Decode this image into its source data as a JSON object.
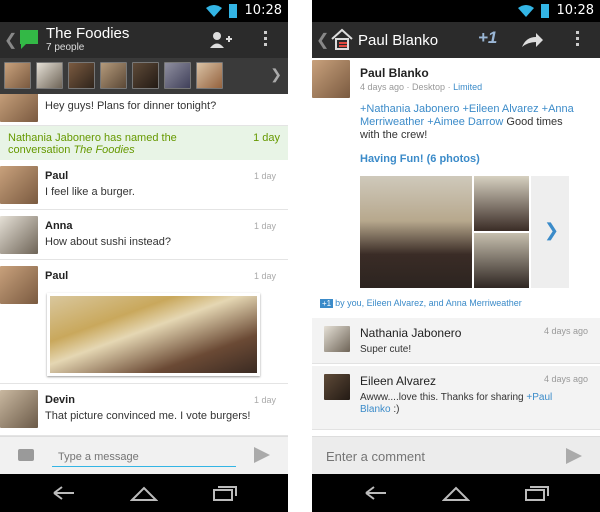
{
  "status": {
    "time": "10:28"
  },
  "left": {
    "title": "The Foodies",
    "subtitle": "7 people",
    "avatars": [
      "person-1",
      "person-2",
      "person-3",
      "person-4",
      "person-5",
      "person-6",
      "person-7"
    ],
    "messages": [
      {
        "name": "",
        "text": "Hey guys! Plans for dinner tonight?",
        "when": ""
      },
      {
        "name": "Paul",
        "text": "I feel like a burger.",
        "when": "1 day"
      },
      {
        "name": "Anna",
        "text": "How about sushi instead?",
        "when": "1 day"
      },
      {
        "name": "Paul",
        "text": "",
        "when": "1 day"
      },
      {
        "name": "Devin",
        "text": "That picture convinced me. I vote burgers!",
        "when": "1 day"
      }
    ],
    "system": {
      "who": "Nathania Jabonero",
      "action": "has named the conversation",
      "conv": "The Foodies",
      "when": "1 day"
    },
    "composer": {
      "placeholder": "Type a message"
    }
  },
  "right": {
    "title": "Paul Blanko",
    "plus_label": "+1",
    "post": {
      "author": "Paul Blanko",
      "time": "4 days ago",
      "source": "Desktop",
      "visibility": "Limited",
      "mentions": [
        "+Nathania Jabonero",
        "+Eileen Alvarez",
        "+Anna Merriweather",
        "+Aimee Darrow"
      ],
      "text_tail": "Good times with the crew!",
      "album": "Having Fun! (6 photos)",
      "plus_ones": "by you, Eileen Alvarez, and Anna Merriweather"
    },
    "comments": [
      {
        "name": "Nathania Jabonero",
        "text": "Super cute!",
        "when": "4 days ago"
      },
      {
        "name": "Eileen Alvarez",
        "text": "Awww....love this. Thanks for sharing",
        "mention": "+Paul Blanko",
        "tail": ":)",
        "when": "4 days ago"
      }
    ],
    "composer": {
      "placeholder": "Enter a comment"
    }
  }
}
